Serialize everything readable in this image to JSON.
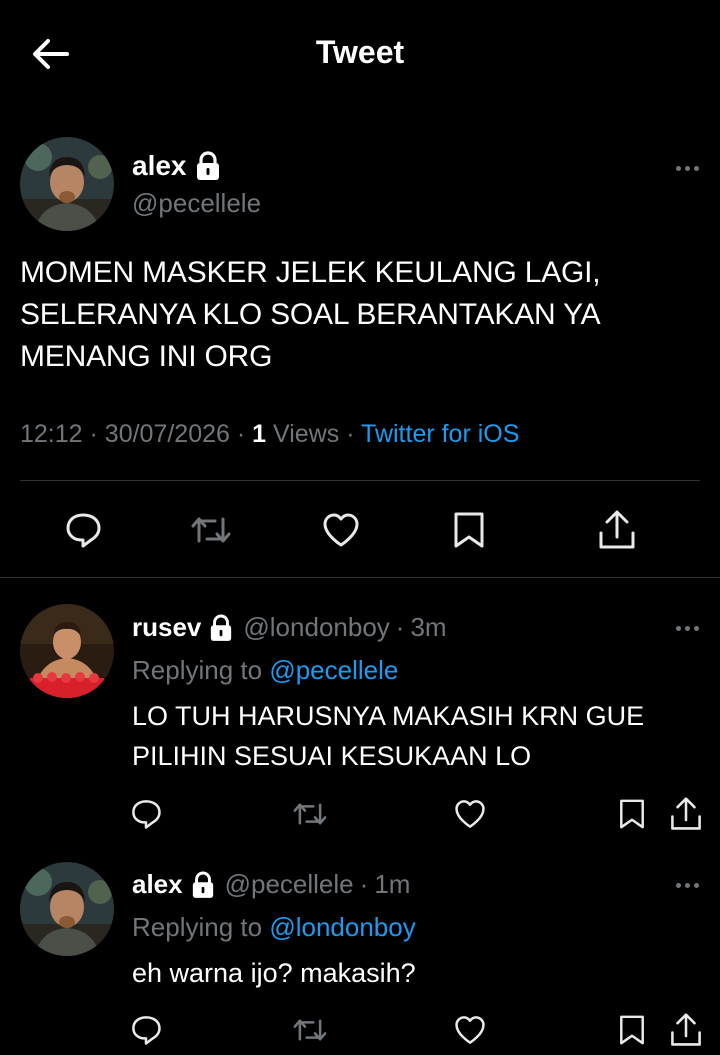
{
  "header": {
    "title": "Tweet",
    "back_icon": "arrow-left-icon"
  },
  "tweet": {
    "name": "alex",
    "handle": "@pecellele",
    "text": "MOMEN MASKER JELEK KEULANG LAGI, SELERANYA KLO SOAL BERANTAKAN YA MENANG INI ORG",
    "time": "12:12",
    "date": "30/07/2026",
    "views_count": "1",
    "views_label": "Views",
    "source": "Twitter for iOS",
    "sep": "·"
  },
  "replies": [
    {
      "name": "rusev",
      "handle": "@londonboy",
      "time": "3m",
      "replying_prefix": "Replying to",
      "replying_to": "@pecellele",
      "text": "LO TUH HARUSNYA MAKASIH KRN GUE PILIHIN SESUAI KESUKAAN LO"
    },
    {
      "name": "alex",
      "handle": "@pecellele",
      "time": "1m",
      "replying_prefix": "Replying to",
      "replying_to": "@londonboy",
      "text": "eh warna ijo? makasih?"
    }
  ],
  "colors": {
    "background": "#000000",
    "text": "#e7e9ea",
    "muted": "#71767b",
    "link": "#1d9bf0",
    "divider": "#2f3336"
  }
}
